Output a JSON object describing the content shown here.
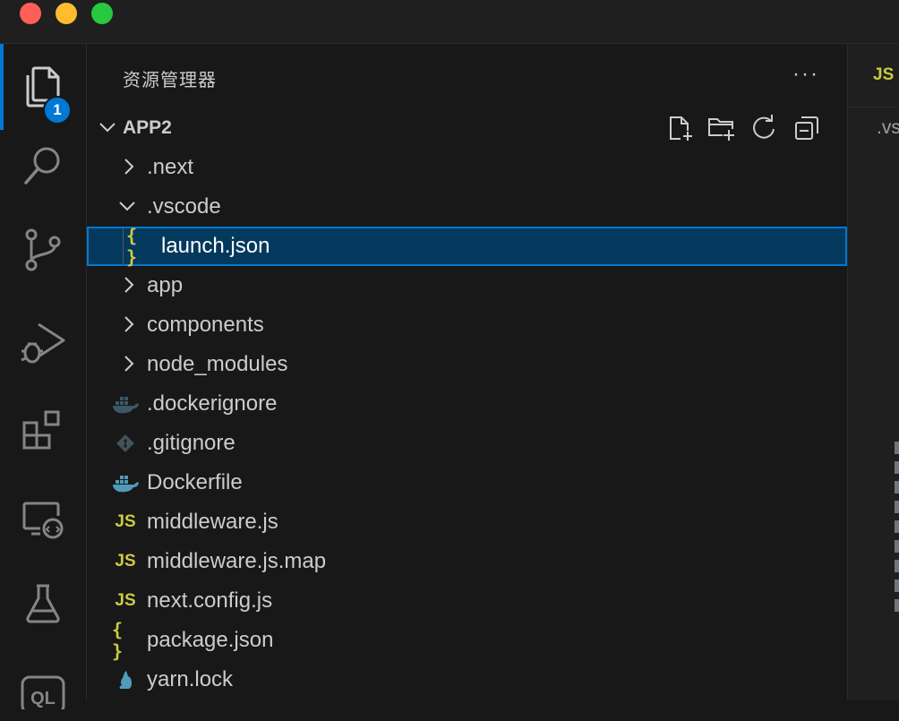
{
  "window": {
    "buttons": [
      "close",
      "minimize",
      "maximize"
    ]
  },
  "activity_bar": {
    "items": [
      {
        "name": "explorer",
        "icon": "files-icon",
        "active": true,
        "badge": "1"
      },
      {
        "name": "search",
        "icon": "search-icon"
      },
      {
        "name": "source-control",
        "icon": "source-control-icon"
      },
      {
        "name": "run-and-debug",
        "icon": "run-debug-icon"
      },
      {
        "name": "extensions",
        "icon": "extensions-icon"
      },
      {
        "name": "remote-explorer",
        "icon": "remote-explorer-icon"
      },
      {
        "name": "testing",
        "icon": "flask-icon"
      },
      {
        "name": "sql",
        "icon": "ql-icon",
        "label": "QL"
      }
    ]
  },
  "sidebar": {
    "title": "资源管理器",
    "more_label": "···",
    "root": {
      "label": "APP2",
      "expanded": true,
      "tools": [
        "new-file-icon",
        "new-folder-icon",
        "refresh-icon",
        "collapse-all-icon"
      ]
    },
    "tree": [
      {
        "label": ".next",
        "kind": "folder",
        "expanded": false
      },
      {
        "label": ".vscode",
        "kind": "folder",
        "expanded": true
      },
      {
        "label": "launch.json",
        "kind": "json",
        "icon_text": "{ }",
        "selected": true,
        "depth": 1
      },
      {
        "label": "app",
        "kind": "folder",
        "expanded": false
      },
      {
        "label": "components",
        "kind": "folder",
        "expanded": false
      },
      {
        "label": "node_modules",
        "kind": "folder",
        "expanded": false
      },
      {
        "label": ".dockerignore",
        "kind": "docker-dim"
      },
      {
        "label": ".gitignore",
        "kind": "git"
      },
      {
        "label": "Dockerfile",
        "kind": "docker"
      },
      {
        "label": "middleware.js",
        "kind": "js",
        "icon_text": "JS"
      },
      {
        "label": "middleware.js.map",
        "kind": "js",
        "icon_text": "JS"
      },
      {
        "label": "next.config.js",
        "kind": "js",
        "icon_text": "JS"
      },
      {
        "label": "package.json",
        "kind": "json",
        "icon_text": "{ }"
      },
      {
        "label": "yarn.lock",
        "kind": "yarn"
      }
    ]
  },
  "editor": {
    "tab_icon_text": "JS",
    "breadcrumb": ".vs"
  },
  "colors": {
    "accent": "#0078d4",
    "selection": "#04395e",
    "js_yellow": "#cbcb41",
    "docker_blue": "#519aba"
  }
}
